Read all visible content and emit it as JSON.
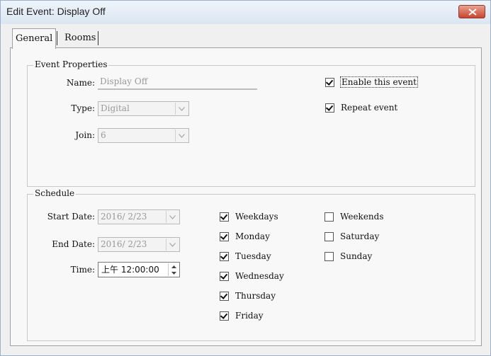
{
  "window": {
    "title": "Edit Event: Display Off",
    "close_icon": "close-icon",
    "close_color": "#c9452f"
  },
  "tabs": [
    {
      "label": "General",
      "selected": true
    },
    {
      "label": "Rooms",
      "selected": false
    }
  ],
  "event_properties": {
    "group_label": "Event Properties",
    "name": {
      "label": "Name:",
      "value": "Display Off"
    },
    "type": {
      "label": "Type:",
      "value": "Digital"
    },
    "join": {
      "label": "Join:",
      "value": "6"
    },
    "enable_event": {
      "label": "Enable this event",
      "checked": true
    },
    "repeat_event": {
      "label": "Repeat event",
      "checked": true
    }
  },
  "schedule": {
    "group_label": "Schedule",
    "start_date": {
      "label": "Start Date:",
      "value": "2016/ 2/23"
    },
    "end_date": {
      "label": "End Date:",
      "value": "2016/ 2/23"
    },
    "time": {
      "label": "Time:",
      "value": "上午 12:00:00"
    },
    "days": [
      {
        "label": "Weekdays",
        "checked": true
      },
      {
        "label": "Monday",
        "checked": true
      },
      {
        "label": "Tuesday",
        "checked": true
      },
      {
        "label": "Wednesday",
        "checked": true
      },
      {
        "label": "Thursday",
        "checked": true
      },
      {
        "label": "Friday",
        "checked": true
      },
      {
        "label": "Weekends",
        "checked": false
      },
      {
        "label": "Saturday",
        "checked": false
      },
      {
        "label": "Sunday",
        "checked": false
      }
    ]
  }
}
